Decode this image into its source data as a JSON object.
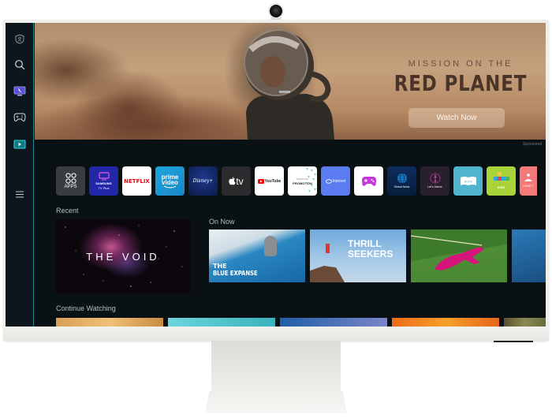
{
  "device": {
    "camera": "webcam",
    "indicator": "status-light"
  },
  "sidebar": {
    "items": [
      {
        "name": "privacy",
        "icon": "shield-person-icon"
      },
      {
        "name": "search",
        "icon": "search-icon"
      },
      {
        "name": "tv-source",
        "icon": "monitor-icon"
      },
      {
        "name": "games",
        "icon": "gamepad-icon"
      },
      {
        "name": "media",
        "icon": "play-icon",
        "active": true
      },
      {
        "name": "menu",
        "icon": "menu-icon"
      }
    ],
    "accent": "#1d8a94"
  },
  "hero": {
    "subtitle": "MISSION ON THE",
    "title": "RED PLANET",
    "button_label": "Watch Now",
    "sponsored_label": "Sponsored"
  },
  "apps": [
    {
      "label": "APPS",
      "icon": "apps-grid-icon",
      "bg": "#3a3d40"
    },
    {
      "label": "SAMSUNG",
      "sub": "TV Plus",
      "icon": "tv-icon",
      "bg": "#2228a8"
    },
    {
      "label": "NETFLIX",
      "bg": "#ffffff",
      "color": "#e50914"
    },
    {
      "label": "prime",
      "sub": "video",
      "bg": "#1a98d5"
    },
    {
      "label": "Disney+",
      "bg": "#0b1a4a"
    },
    {
      "label": "tv",
      "icon": "apple-icon",
      "bg": "#2b2b2d"
    },
    {
      "label": "YouTube",
      "icon": "youtube-play-icon",
      "bg": "#ffffff"
    },
    {
      "label": "PROMOTION",
      "sub": "SAMSUNG",
      "bg": "#ffffff"
    },
    {
      "label": "Internet",
      "icon": "internet-icon",
      "bg": "#5b7cf0"
    },
    {
      "label": "",
      "icon": "gamepad-icon",
      "bg": "#ffffff"
    },
    {
      "label": "Global News",
      "icon": "globe-icon",
      "bg": "#0c2d5e"
    },
    {
      "label": "Let's Dance",
      "icon": "dancer-icon",
      "bg": "#2a1f2e"
    },
    {
      "label": "BOOK",
      "icon": "book-icon",
      "bg": "#4fb5cf"
    },
    {
      "label": "KIDS",
      "icon": "abcd-blocks-icon",
      "bg": "#a8d43a"
    },
    {
      "label": "HOME T",
      "icon": "yoga-icon",
      "bg": "#f47a7a"
    }
  ],
  "recent": {
    "title": "Recent",
    "items": [
      {
        "title": "THE VOID"
      }
    ]
  },
  "on_now": {
    "title": "On Now",
    "items": [
      {
        "title_line1": "THE",
        "title_line2": "BLUE EXPANSE"
      },
      {
        "title_line1": "THRILL",
        "title_line2": "SEEKERS"
      },
      {
        "title_line1": "",
        "title_line2": ""
      },
      {
        "title_line1": "",
        "title_line2": ""
      }
    ]
  },
  "continue_watching": {
    "title": "Continue Watching",
    "items": [
      {},
      {},
      {},
      {},
      {}
    ]
  }
}
